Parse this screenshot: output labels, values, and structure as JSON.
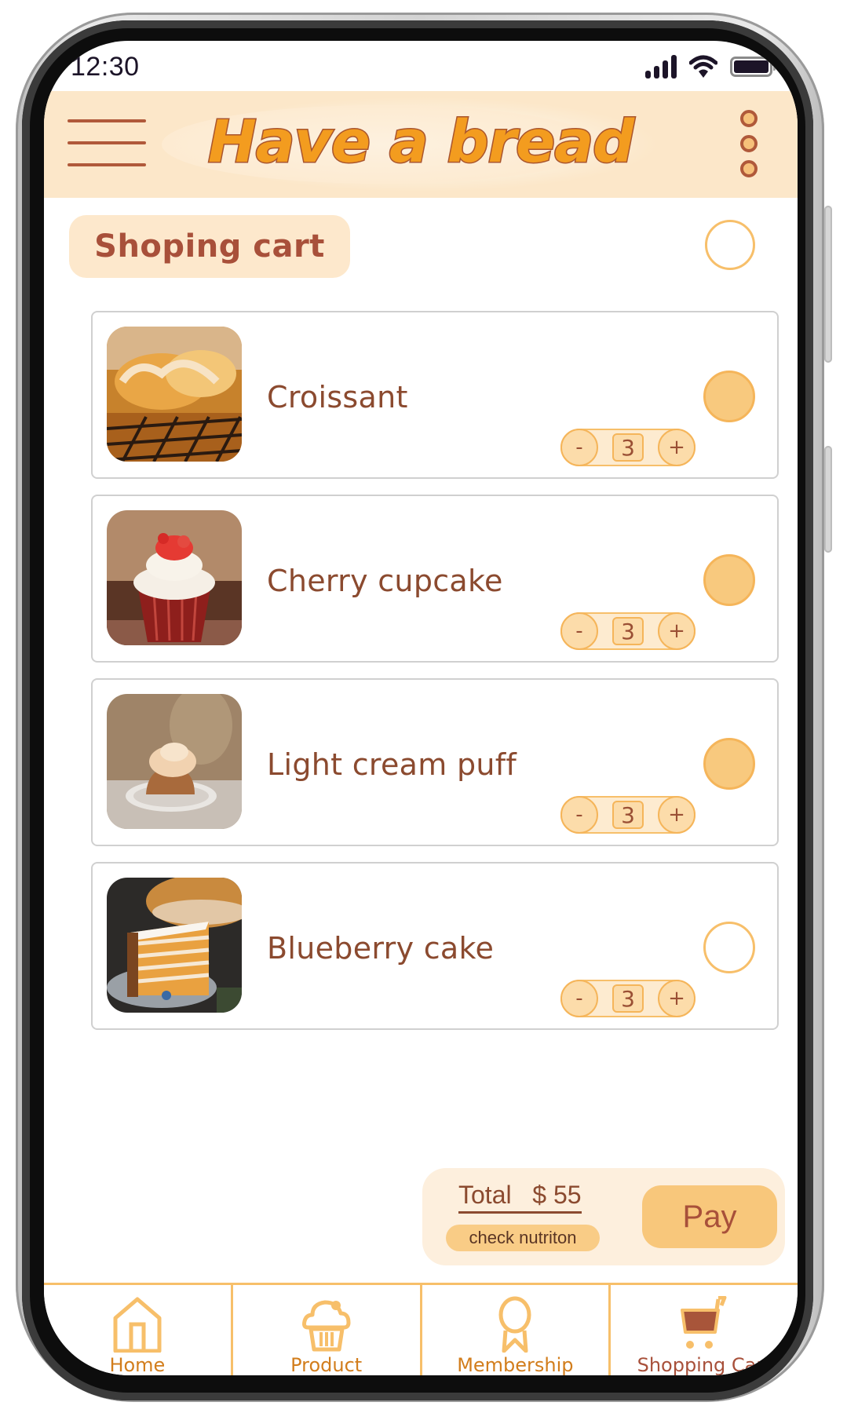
{
  "status_bar": {
    "time": "12:30",
    "icons": [
      "signal-icon",
      "wifi-icon",
      "battery-icon"
    ]
  },
  "header": {
    "title": "Have a bread",
    "menu_icon": "hamburger-menu-icon",
    "more_icon": "more-vertical-icon"
  },
  "cart": {
    "heading": "Shoping cart",
    "select_all_checked": false,
    "items": [
      {
        "name": "Croissant",
        "quantity": "3",
        "selected": true,
        "image": "croissant-photo"
      },
      {
        "name": "Cherry cupcake",
        "quantity": "3",
        "selected": true,
        "image": "cherry-cupcake-photo"
      },
      {
        "name": "Light cream puff",
        "quantity": "3",
        "selected": true,
        "image": "cream-puff-photo"
      },
      {
        "name": "Blueberry cake",
        "quantity": "3",
        "selected": false,
        "image": "blueberry-cake-photo"
      }
    ],
    "stepper": {
      "minus": "-",
      "plus": "+"
    }
  },
  "summary": {
    "total_label": "Total",
    "total_value": "$ 55",
    "total_text": "Total   $ 55",
    "nutrition_label": "check nutriton",
    "pay_label": "Pay"
  },
  "bottom_nav": {
    "items": [
      {
        "label": "Home",
        "icon": "home-icon",
        "active": false
      },
      {
        "label": "Product",
        "icon": "cupcake-icon",
        "active": false
      },
      {
        "label": "Membership",
        "icon": "award-ribbon-icon",
        "active": false
      },
      {
        "label": "Shopping Cart",
        "icon": "shopping-cart-icon",
        "active": true
      }
    ]
  },
  "colors": {
    "brand_orange": "#f39c1f",
    "brand_brown": "#a8503a",
    "accent_light": "#fde8cc",
    "checkbox_fill": "#f8c97e",
    "border_orange": "#f7bf6a"
  }
}
